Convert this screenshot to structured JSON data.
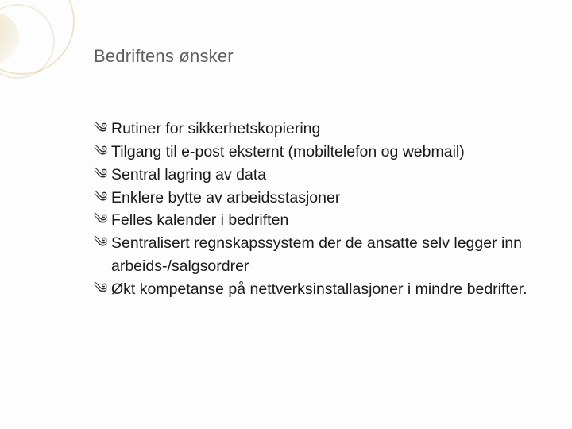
{
  "title": "Bedriftens ønsker",
  "bullets": {
    "b0": "Rutiner for sikkerhetskopiering",
    "b1": "Tilgang til e-post eksternt (mobiltelefon og webmail)",
    "b2": "Sentral lagring av data",
    "b3": "Enklere bytte av arbeidsstasjoner",
    "b4": "Felles kalender i bedriften",
    "b5": "Sentralisert regnskapssystem der de ansatte selv legger inn arbeids-/salgsordrer",
    "b6": "Økt kompetanse på nettverksinstallasjoner i mindre bedrifter."
  },
  "bullet_glyph": "༄"
}
